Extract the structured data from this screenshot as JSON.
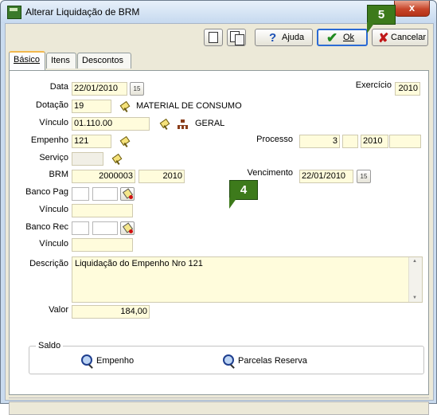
{
  "window": {
    "title": "Alterar Liquidação de BRM",
    "close_label": "x"
  },
  "toolbar": {
    "help_label": "Ajuda",
    "ok_label": "Ok",
    "cancel_label": "Cancelar"
  },
  "tabs": [
    {
      "label": "Básico",
      "active": true
    },
    {
      "label": "Itens",
      "active": false
    },
    {
      "label": "Descontos",
      "active": false
    }
  ],
  "form": {
    "data_label": "Data",
    "data_value": "22/01/2010",
    "exercicio_label": "Exercício",
    "exercicio_value": "2010",
    "dotacao_label": "Dotação",
    "dotacao_value": "19",
    "dotacao_desc": "MATERIAL DE CONSUMO",
    "vinculo_label": "Vínculo",
    "vinculo_value": "01.110.00",
    "vinculo_desc": "GERAL",
    "empenho_label": "Empenho",
    "empenho_value": "121",
    "processo_label": "Processo",
    "processo_num": "3",
    "processo_mid": "",
    "processo_year": "2010",
    "processo_extra": "",
    "servico_label": "Serviço",
    "servico_value": "",
    "brm_label": "BRM",
    "brm_value": "2000003",
    "brm_year": "2010",
    "vencimento_label": "Vencimento",
    "vencimento_value": "22/01/2010",
    "banco_pag_label": "Banco Pag",
    "banco_pag_value1": "",
    "banco_pag_value2": "",
    "vinculo_pag_label": "Vínculo",
    "vinculo_pag_value": "",
    "banco_rec_label": "Banco Rec",
    "banco_rec_value1": "",
    "banco_rec_value2": "",
    "vinculo_rec_label": "Vínculo",
    "vinculo_rec_value": "",
    "descricao_label": "Descrição",
    "descricao_value": "Liquidação do Empenho Nro 121",
    "valor_label": "Valor",
    "valor_value": "184,00",
    "calendar_label": "15"
  },
  "saldo": {
    "title": "Saldo",
    "empenho_label": "Empenho",
    "parcelas_label": "Parcelas Reserva"
  },
  "callouts": {
    "c4": "4",
    "c5": "5"
  },
  "colors": {
    "field_bg": "#fffcdc",
    "callout": "#3d7a1b",
    "title_bar": "#c6d9ef"
  }
}
